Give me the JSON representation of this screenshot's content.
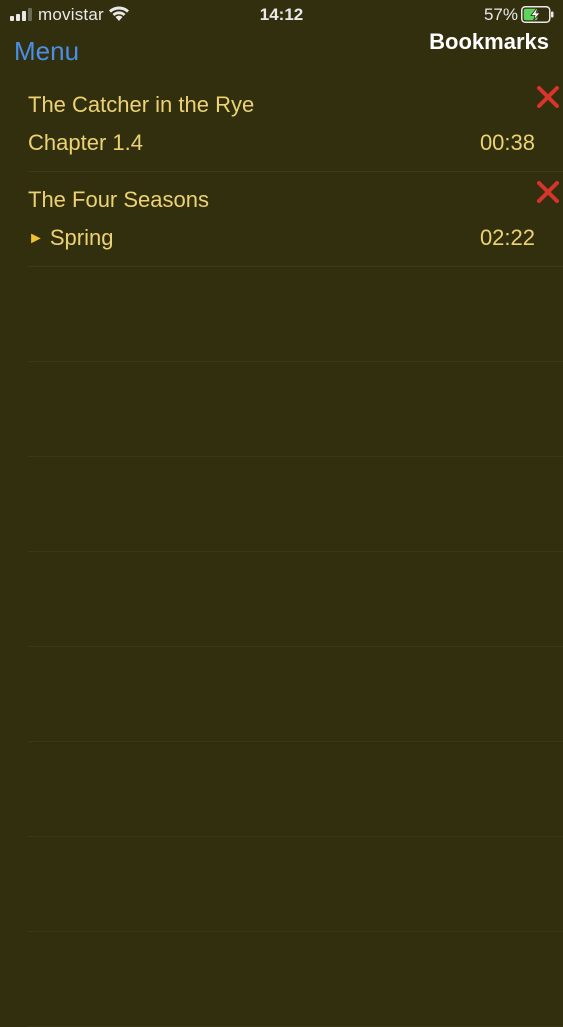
{
  "status_bar": {
    "carrier": "movistar",
    "time": "14:12",
    "battery_percent": "57%",
    "battery_level": 0.57,
    "signal_icon": "signal-bars-icon",
    "wifi_icon": "wifi-icon",
    "battery_icon": "battery-charging-icon"
  },
  "nav": {
    "back_label": "Menu",
    "title": "Bookmarks"
  },
  "bookmarks": [
    {
      "title": "The Catcher in the Rye",
      "subtitle": "Chapter 1.4",
      "time": "00:38",
      "playing": false
    },
    {
      "title": "The Four Seasons",
      "subtitle": "Spring",
      "time": "02:22",
      "playing": true,
      "play_glyph": "►"
    }
  ],
  "colors": {
    "background": "#322f0e",
    "text": "#ecd272",
    "link": "#4a8ee6",
    "delete": "#d9342b"
  }
}
